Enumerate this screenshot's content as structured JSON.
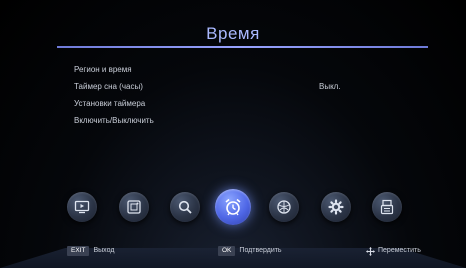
{
  "header": {
    "title": "Время"
  },
  "menu": {
    "items": [
      {
        "label": "Регион и время",
        "value": ""
      },
      {
        "label": "Таймер сна (часы)",
        "value": "Выкл."
      },
      {
        "label": "Установки таймера",
        "value": ""
      },
      {
        "label": "Включить/Выключить",
        "value": ""
      }
    ]
  },
  "dock": {
    "icons": [
      "tv-icon",
      "media-icon",
      "search-icon",
      "alarm-clock-icon",
      "internet-icon",
      "settings-gear-icon",
      "system-icon"
    ],
    "active_index": 3
  },
  "footer": {
    "exit_key": "EXIT",
    "exit_label": "Выход",
    "ok_key": "OK",
    "ok_label": "Подтвердить",
    "move_label": "Переместить"
  },
  "colors": {
    "accent": "#5b6ff0",
    "title": "#aab9ff",
    "line": "#8a96f0"
  }
}
